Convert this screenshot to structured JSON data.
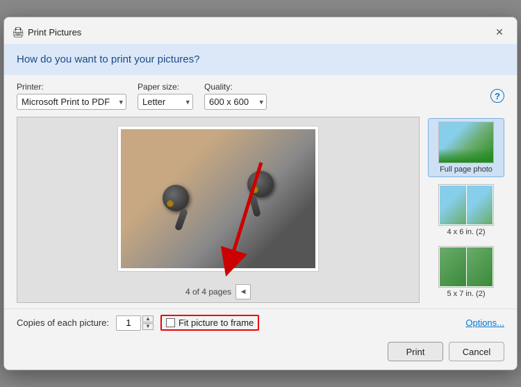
{
  "dialog": {
    "title": "Print Pictures",
    "close_label": "✕"
  },
  "header": {
    "question": "How do you want to print your pictures?"
  },
  "controls": {
    "printer_label": "Printer:",
    "printer_value": "Microsoft Print to PDF",
    "paper_label": "Paper size:",
    "paper_value": "Letter",
    "quality_label": "Quality:",
    "quality_value": "600 x 600",
    "help_label": "?"
  },
  "preview": {
    "page_text": "4 of 4 pages"
  },
  "layouts": [
    {
      "label": "Full page photo",
      "type": "full",
      "selected": true
    },
    {
      "label": "4 x 6 in. (2)",
      "type": "4x6",
      "selected": false
    },
    {
      "label": "5 x 7 in. (2)",
      "type": "5x7",
      "selected": false
    }
  ],
  "bottom": {
    "copies_label": "Copies of each picture:",
    "copies_value": "1",
    "fit_label": "Fit picture to frame",
    "options_label": "Options..."
  },
  "actions": {
    "print_label": "Print",
    "cancel_label": "Cancel"
  }
}
